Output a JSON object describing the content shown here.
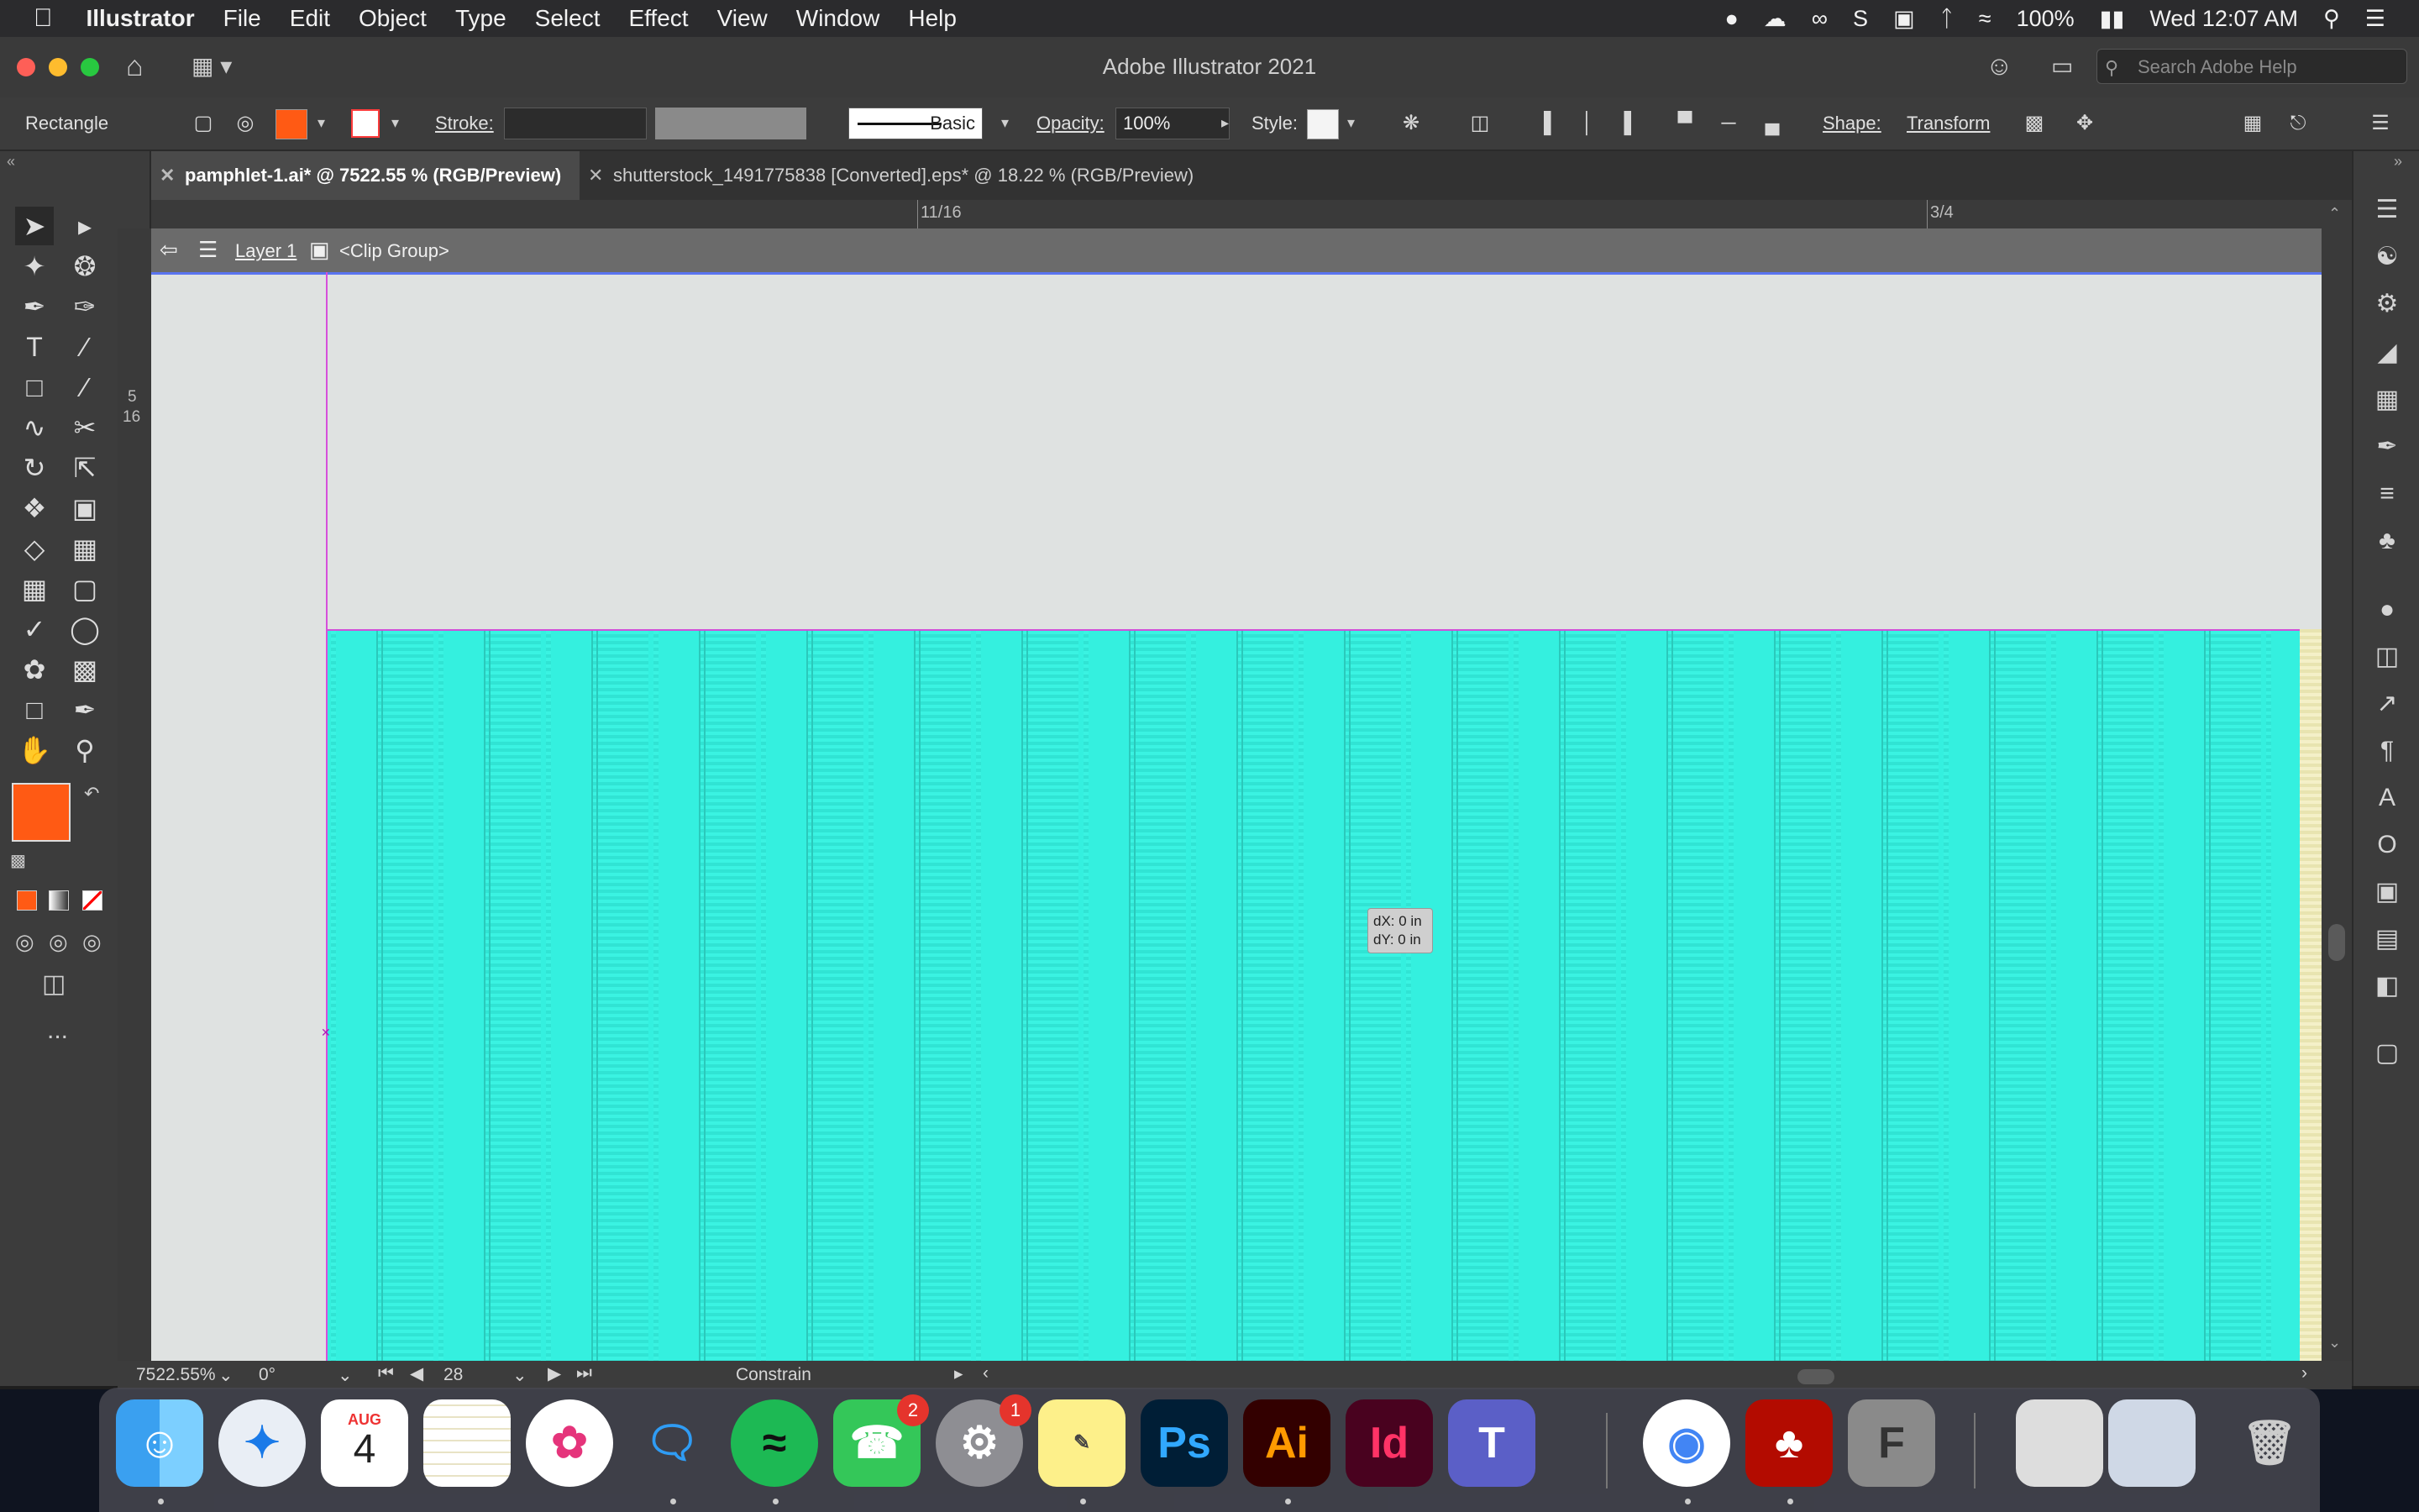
{
  "menubar": {
    "app_name": "Illustrator",
    "items": [
      "File",
      "Edit",
      "Object",
      "Type",
      "Select",
      "Effect",
      "View",
      "Window",
      "Help"
    ],
    "battery": "100%",
    "clock": "Wed 12:07 AM"
  },
  "window": {
    "title": "Adobe Illustrator 2021",
    "search_placeholder": "Search Adobe Help"
  },
  "control": {
    "selection_type": "Rectangle",
    "fill_color": "#ff5a14",
    "stroke_label": "Stroke:",
    "brush_label": "Basic",
    "opacity_label": "Opacity:",
    "opacity_value": "100%",
    "style_label": "Style:",
    "shape_label": "Shape:",
    "transform_label": "Transform"
  },
  "tabs": [
    {
      "label": "pamphlet-1.ai* @ 7522.55 % (RGB/Preview)",
      "active": true
    },
    {
      "label": "shutterstock_1491775838 [Converted].eps* @ 18.22 % (RGB/Preview)",
      "active": false
    }
  ],
  "rulers": {
    "h_ticks": [
      "11/16",
      "3/4"
    ],
    "v_ticks": [
      "5",
      "16"
    ]
  },
  "breadcrumb": {
    "layer": "Layer 1",
    "group": "<Clip Group>"
  },
  "canvas": {
    "tooltip_dx": "dX: 0 in",
    "tooltip_dy": "dY: 0 in",
    "pattern_color": "#34f0df"
  },
  "status": {
    "zoom": "7522.55%",
    "rotation": "0°",
    "artboard": "28",
    "mode": "Constrain"
  },
  "toolbar": {
    "fill_color": "#ff5a14",
    "more_label": "..."
  },
  "dock": {
    "calendar_month": "AUG",
    "calendar_day": "4",
    "facetime_badge": "2",
    "settings_badge": "1",
    "ps_label": "Ps",
    "ai_label": "Ai",
    "id_label": "Id"
  }
}
